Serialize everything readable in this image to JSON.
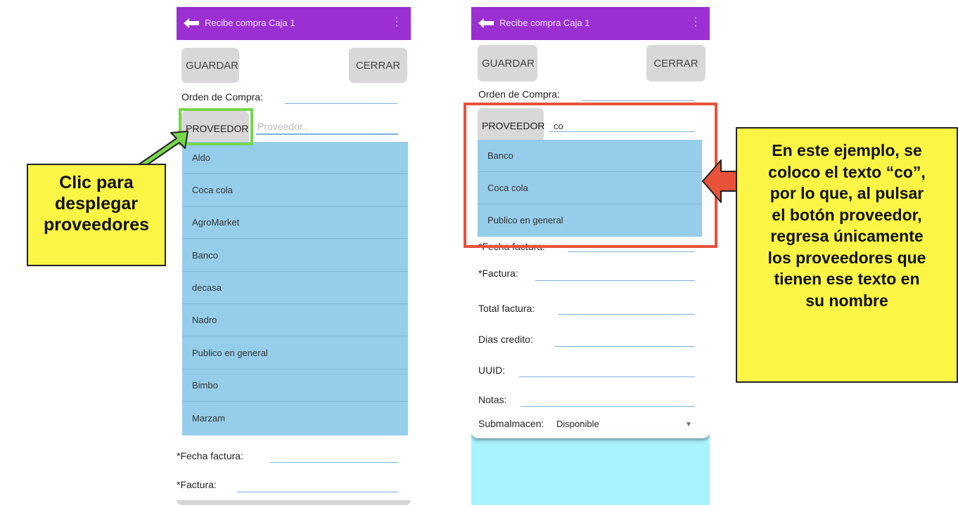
{
  "left_phone": {
    "appbar": {
      "title": "Recibe compra Caja 1",
      "menu_icon": "more-vert"
    },
    "buttons": {
      "guardar": "GUARDAR",
      "cerrar": "CERRAR",
      "proveedor": "PROVEEDOR"
    },
    "orden_compra_label": "Orden de Compra:",
    "proveedor_placeholder": "Proveedor..",
    "dropdown_items": [
      "Aldo",
      "Coca cola",
      "AgroMarket",
      "Banco",
      "decasa",
      "Nadro",
      "Publico en general",
      "Bimbo",
      "Marzam"
    ],
    "fecha_factura_label": "*Fecha factura:",
    "factura_label": "*Factura:"
  },
  "right_phone": {
    "appbar": {
      "title": "Recibe compra Caja 1",
      "menu_icon": "more-vert"
    },
    "buttons": {
      "guardar": "GUARDAR",
      "cerrar": "CERRAR",
      "proveedor": "PROVEEDOR"
    },
    "orden_compra_label": "Orden de Compra:",
    "proveedor_value": "co",
    "dropdown_items": [
      "Banco",
      "Coca cola",
      "Publico en general"
    ],
    "fecha_factura_label": "*Fecha factura:",
    "factura_label": "*Factura:",
    "total_factura_label": "Total factura:",
    "dias_credito_label": "Dias credito:",
    "uuid_label": "UUID:",
    "notas_label": "Notas:",
    "submalmacen_label": "Submalmacen:",
    "submalmacen_value": "Disponible"
  },
  "callouts": {
    "left": [
      "Clic para",
      "desplegar",
      "proveedores"
    ],
    "right": [
      "En este ejemplo, se",
      "coloco el texto “co”,",
      "por lo que, al pulsar",
      "el botón proveedor,",
      "regresa únicamente",
      "los proveedores que",
      "tienen ese texto en",
      "su nombre"
    ]
  },
  "colors": {
    "appbar": "#9b2fd1",
    "dropdown": "#96cdea",
    "callout": "#fbf545",
    "green_highlight": "#78d64b",
    "red_highlight": "#e8513a",
    "cyan_background": "#a7f3ff"
  }
}
